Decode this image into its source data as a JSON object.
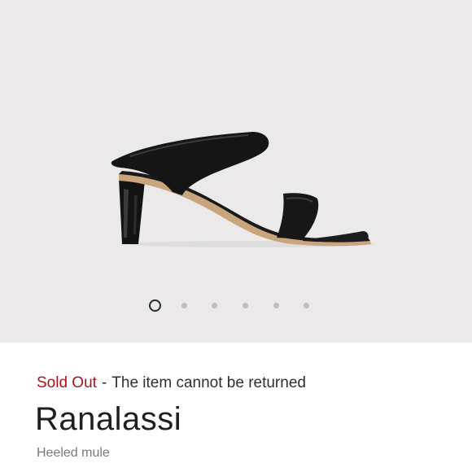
{
  "gallery": {
    "image": "black-heeled-mule-sandal",
    "background_color": "#ebe9ea",
    "pagination": {
      "total_dots": 6,
      "active_index": 0
    }
  },
  "product": {
    "status": "Sold Out",
    "status_color": "#a8151b",
    "separator": "-",
    "return_policy": "The item cannot be returned",
    "title": "Ranalassi",
    "subtitle": "Heeled mule"
  }
}
